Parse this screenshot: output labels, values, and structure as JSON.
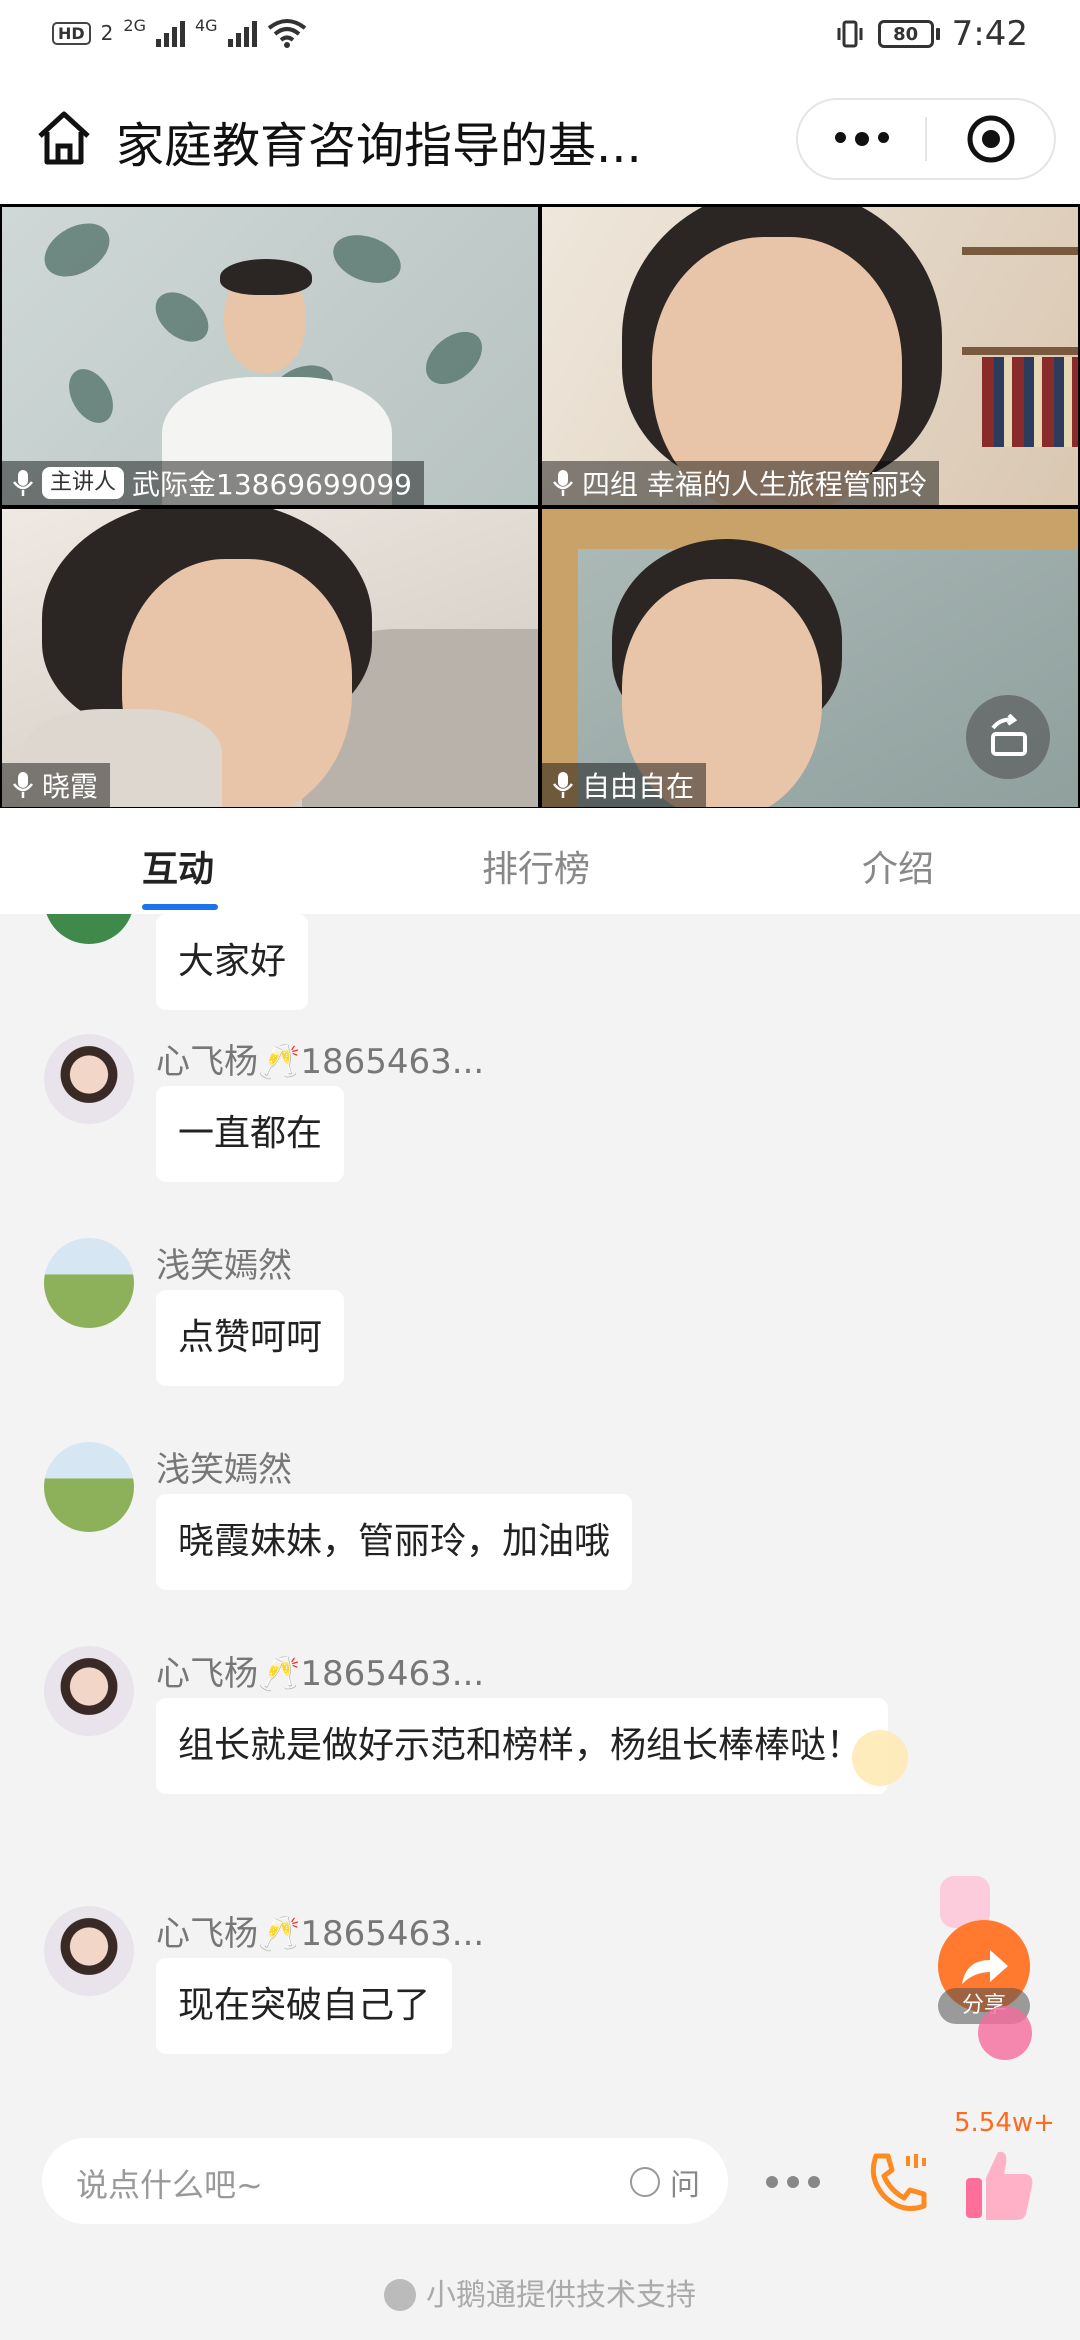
{
  "status_bar": {
    "hd_label": "HD",
    "hd_sub": "2",
    "net_a": "2G",
    "net_b": "4G",
    "battery": "80",
    "time": "7:42"
  },
  "header": {
    "title": "家庭教育咨询指导的基..."
  },
  "video": {
    "tiles": [
      {
        "name": "武际金13869699099",
        "badge": "主讲人"
      },
      {
        "name": "四组 幸福的人生旅程管丽玲"
      },
      {
        "name": "晓霞"
      },
      {
        "name": "自由自在"
      }
    ]
  },
  "tabs": [
    {
      "label": "互动",
      "active": true
    },
    {
      "label": "排行榜",
      "active": false
    },
    {
      "label": "介绍",
      "active": false
    }
  ],
  "chat": {
    "messages": [
      {
        "user": "",
        "text": "大家好"
      },
      {
        "user": "心飞杨🥂1865463...",
        "text": "一直都在"
      },
      {
        "user": "浅笑嫣然",
        "text": "点赞呵呵"
      },
      {
        "user": "浅笑嫣然",
        "text": "晓霞妹妹，管丽玲，加油哦"
      },
      {
        "user": "心飞杨🥂1865463...",
        "text": "组长就是做好示范和榜样，杨组长棒棒哒！"
      },
      {
        "user": "心飞杨🥂1865463...",
        "text": "现在突破自己了"
      }
    ]
  },
  "share": {
    "label": "分享"
  },
  "bottom": {
    "placeholder": "说点什么吧~",
    "ask_label": "问",
    "like_count": "5.54w+",
    "footer": "小鹅通提供技术支持"
  },
  "colors": {
    "accent_blue": "#1a73e8",
    "share_orange": "#ff7a2f",
    "like_count_orange": "#ff6a1f"
  }
}
